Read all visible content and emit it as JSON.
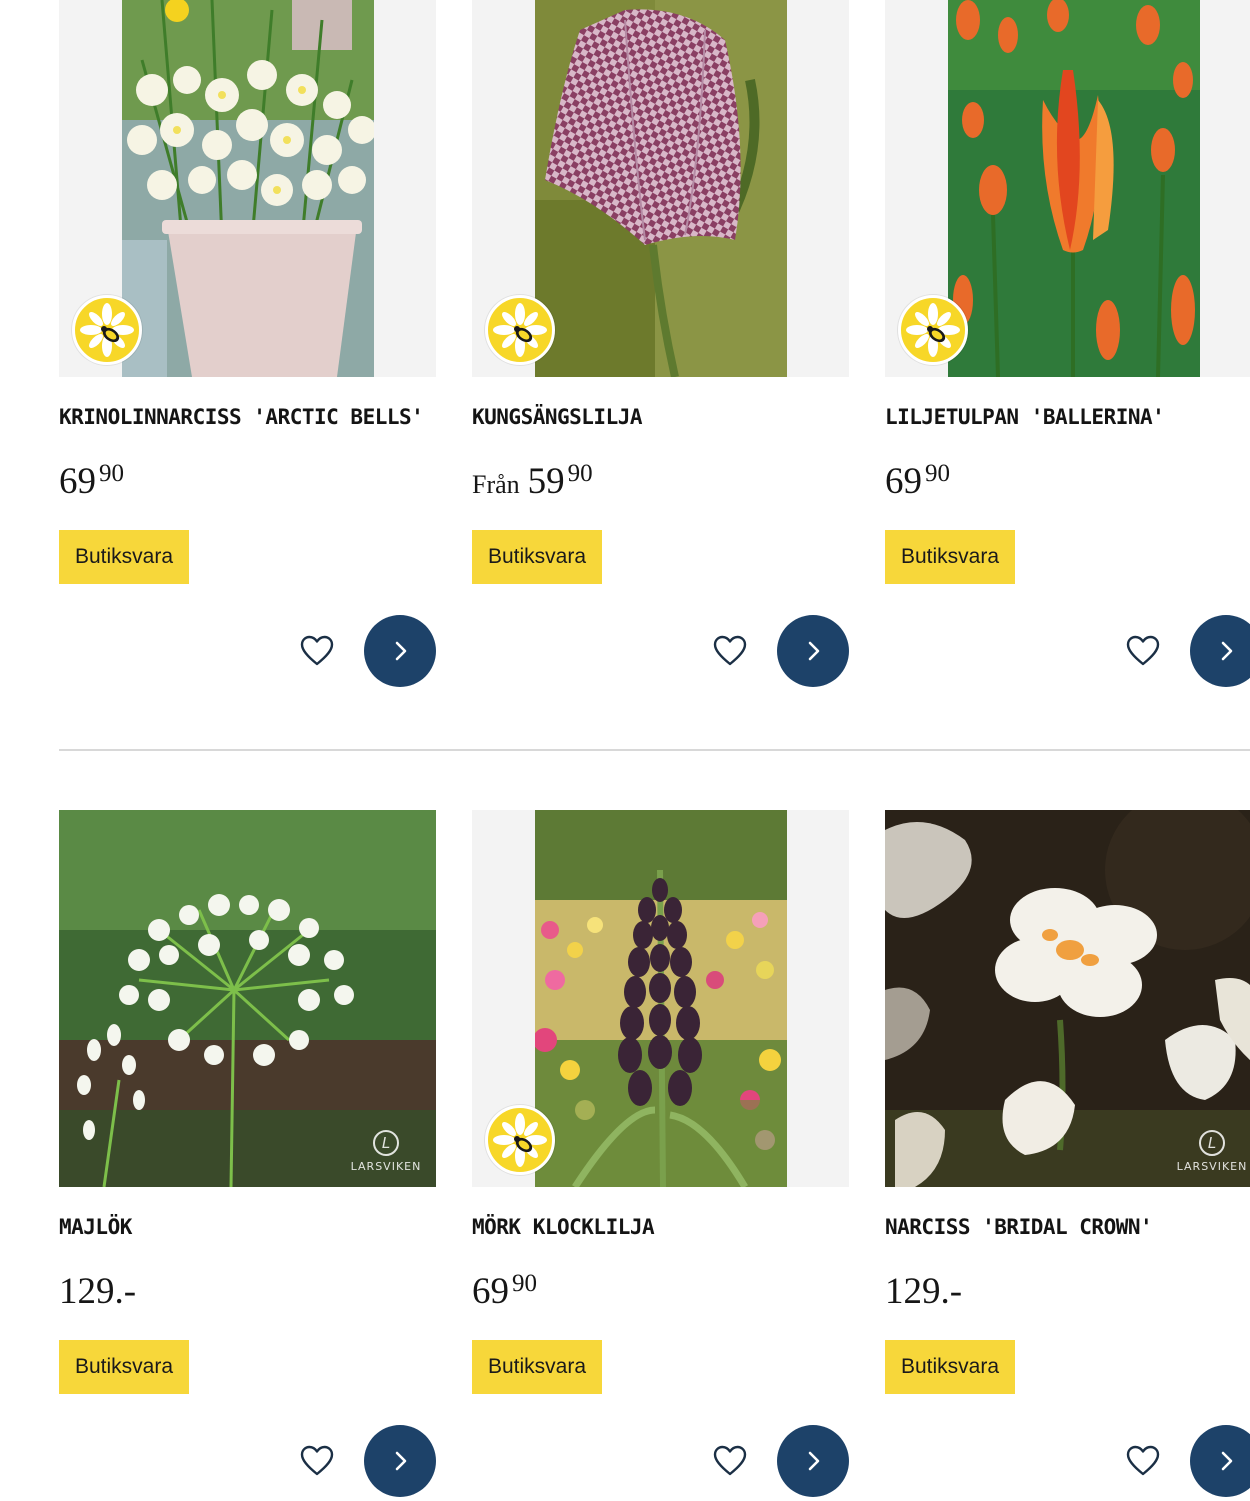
{
  "products": [
    {
      "name": "KRINOLINNARCISS 'ARCTIC BELLS'",
      "price_prefix": "",
      "price_main": "69",
      "price_sup": "90",
      "tag": "Butiksvara",
      "bee_badge": true,
      "watermark": ""
    },
    {
      "name": "KUNGSÄNGSLILJA",
      "price_prefix": "Från",
      "price_main": "59",
      "price_sup": "90",
      "tag": "Butiksvara",
      "bee_badge": true,
      "watermark": ""
    },
    {
      "name": "LILJETULPAN 'BALLERINA'",
      "price_prefix": "",
      "price_main": "69",
      "price_sup": "90",
      "tag": "Butiksvara",
      "bee_badge": true,
      "watermark": ""
    },
    {
      "name": "MAJLÖK",
      "price_prefix": "",
      "price_main": "129.-",
      "price_sup": "",
      "tag": "Butiksvara",
      "bee_badge": false,
      "watermark": "LARSVIKEN"
    },
    {
      "name": "MÖRK KLOCKLILJA",
      "price_prefix": "",
      "price_main": "69",
      "price_sup": "90",
      "tag": "Butiksvara",
      "bee_badge": true,
      "watermark": ""
    },
    {
      "name": "NARCISS 'BRIDAL CROWN'",
      "price_prefix": "",
      "price_main": "129.-",
      "price_sup": "",
      "tag": "Butiksvara",
      "bee_badge": false,
      "watermark": "LARSVIKEN"
    }
  ],
  "icons": {
    "favorite": "heart-outline-icon",
    "open": "chevron-right-icon",
    "badge": "bee-flower-icon"
  },
  "colors": {
    "tag_bg": "#f7d73a",
    "button_bg": "#1d4269",
    "badge_bg": "#f7d728"
  }
}
